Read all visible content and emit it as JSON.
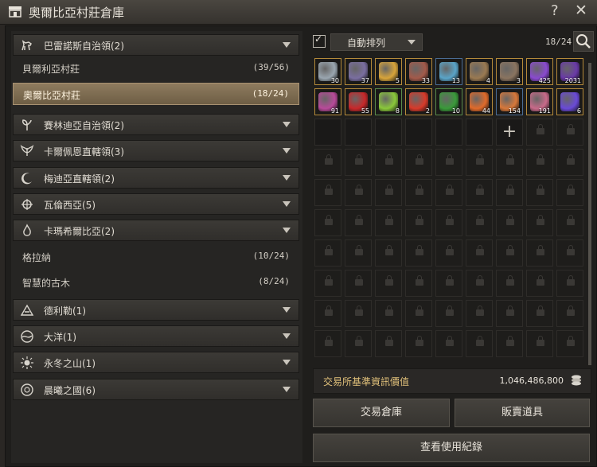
{
  "window": {
    "title": "奧爾比亞村莊倉庫",
    "help": "?",
    "close": "✕"
  },
  "regions": [
    {
      "icon": "horse-icon",
      "label": "巴雷諾斯自治領(2)"
    },
    {
      "icon": "sprout-icon",
      "label": "賽林迪亞自治領(2)"
    },
    {
      "icon": "wings-icon",
      "label": "卡爾佩恩直轄領(3)"
    },
    {
      "icon": "moon-icon",
      "label": "梅迪亞直轄領(2)"
    },
    {
      "icon": "emblem-icon",
      "label": "瓦倫西亞(5)"
    },
    {
      "icon": "flame-icon",
      "label": "卡瑪希爾比亞(2)"
    },
    {
      "icon": "mountain-icon",
      "label": "德利勒(1)"
    },
    {
      "icon": "ocean-icon",
      "label": "大洋(1)"
    },
    {
      "icon": "sun-icon",
      "label": "永冬之山(1)"
    },
    {
      "icon": "dawn-icon",
      "label": "晨曦之國(6)"
    }
  ],
  "towns": [
    {
      "label": "貝爾利亞村莊",
      "count": "(39/56)"
    },
    {
      "label": "奧爾比亞村莊",
      "count": "(18/24)"
    },
    {
      "label": "格拉納",
      "count": "(10/24)"
    },
    {
      "label": "智慧的古木",
      "count": "(8/24)"
    }
  ],
  "storage": {
    "auto_sort_label": "自動排列",
    "auto_sort_checked": "✓",
    "slot_count": "18/24",
    "items": [
      {
        "q": "30",
        "color": "#9aa6b0",
        "frame": "gold"
      },
      {
        "q": "37",
        "color": "#7a6ea0",
        "frame": "gold"
      },
      {
        "q": "5",
        "color": "#d8a43a",
        "frame": "gold"
      },
      {
        "q": "33",
        "color": "#a35a4a",
        "frame": "gold"
      },
      {
        "q": "13",
        "color": "#5aa4c8",
        "frame": "blue"
      },
      {
        "q": "4",
        "color": "#9a7a52",
        "frame": "gold"
      },
      {
        "q": "3",
        "color": "#8a7460",
        "frame": "gold"
      },
      {
        "q": "425",
        "color": "#8a4ad0",
        "frame": "gold"
      },
      {
        "q": "2031",
        "color": "#6a3aa8",
        "frame": "gold"
      },
      {
        "q": "91",
        "color": "#b84a9a",
        "frame": "gold"
      },
      {
        "q": "55",
        "color": "#c8282a",
        "frame": "gold"
      },
      {
        "q": "8",
        "color": "#8ac83a",
        "frame": "green"
      },
      {
        "q": "2",
        "color": "#d83a2a",
        "frame": "gold"
      },
      {
        "q": "10",
        "color": "#3a9a3a",
        "frame": "green"
      },
      {
        "q": "44",
        "color": "#e06a2a",
        "frame": "gold"
      },
      {
        "q": "154",
        "color": "#d8783a",
        "frame": "blue"
      },
      {
        "q": "191",
        "color": "#c86a8a",
        "frame": "gold"
      },
      {
        "q": "6",
        "color": "#6a4ad8",
        "frame": "gold"
      }
    ],
    "expand_symbol": "+"
  },
  "market": {
    "label": "交易所基準資訊價值",
    "value": "1,046,486,800"
  },
  "buttons": {
    "trade": "交易倉庫",
    "sell": "販賣道具",
    "history": "查看使用紀錄"
  }
}
